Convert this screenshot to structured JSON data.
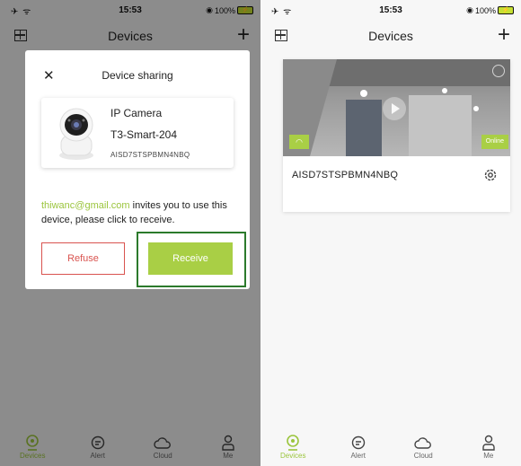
{
  "left": {
    "status": {
      "left": "✈ ︎ᯤ",
      "time": "15:53",
      "battery": "100%"
    },
    "nav": {
      "title": "Devices"
    },
    "dialog": {
      "title": "Device sharing",
      "device_name": "IP Camera",
      "device_model": "T3-Smart-204",
      "device_sn": "AISD7STSPBMN4NBQ",
      "invite_email": "thiwanc@gmail.com",
      "invite_text": " invites you to use this device, please click to receive.",
      "refuse_label": "Refuse",
      "receive_label": "Receive"
    },
    "tabs": [
      "Devices",
      "Alert",
      "Cloud",
      "Me"
    ]
  },
  "right": {
    "status": {
      "left": "✈ ︎ᯤ",
      "time": "15:53",
      "battery": "100%"
    },
    "nav": {
      "title": "Devices"
    },
    "card": {
      "name": "AISD7STSPBMN4NBQ",
      "status": "Online"
    },
    "tabs": [
      "Devices",
      "Alert",
      "Cloud",
      "Me"
    ]
  },
  "colors": {
    "accent": "#a9cf45",
    "refuse": "#d9534f",
    "highlight": "#2c7a2c"
  }
}
